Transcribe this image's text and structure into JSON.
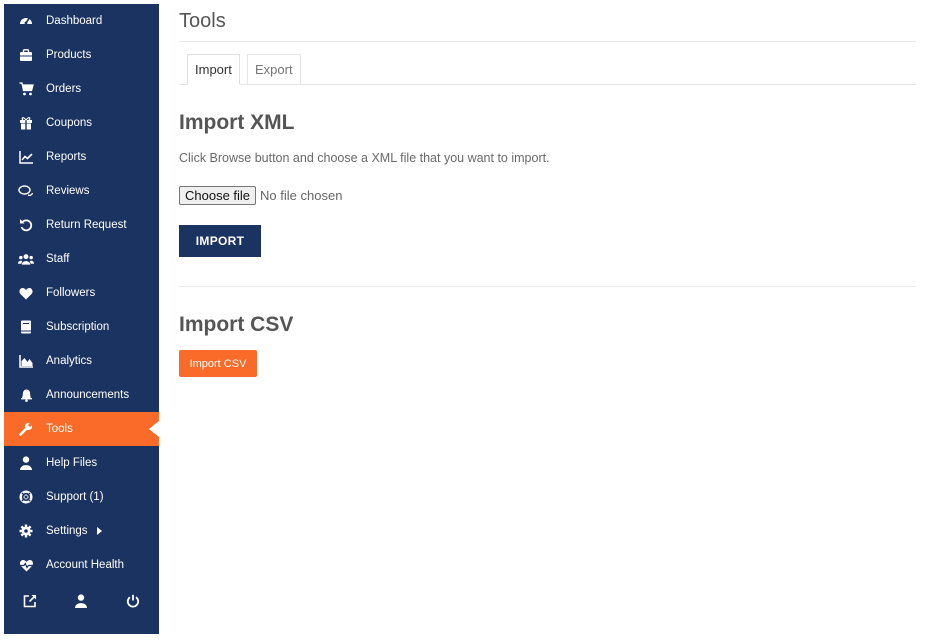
{
  "sidebar": {
    "items": [
      {
        "label": "Dashboard",
        "icon": "dashboard-icon"
      },
      {
        "label": "Products",
        "icon": "briefcase-icon"
      },
      {
        "label": "Orders",
        "icon": "cart-icon"
      },
      {
        "label": "Coupons",
        "icon": "gift-icon"
      },
      {
        "label": "Reports",
        "icon": "line-chart-icon"
      },
      {
        "label": "Reviews",
        "icon": "comments-icon"
      },
      {
        "label": "Return Request",
        "icon": "undo-icon"
      },
      {
        "label": "Staff",
        "icon": "users-icon"
      },
      {
        "label": "Followers",
        "icon": "heart-icon"
      },
      {
        "label": "Subscription",
        "icon": "book-icon"
      },
      {
        "label": "Analytics",
        "icon": "area-chart-icon"
      },
      {
        "label": "Announcements",
        "icon": "bell-icon"
      },
      {
        "label": "Tools",
        "icon": "wrench-icon",
        "active": true
      },
      {
        "label": "Help Files",
        "icon": "user-icon"
      },
      {
        "label": "Support (1)",
        "icon": "life-ring-icon"
      },
      {
        "label": "Settings",
        "icon": "gear-icon"
      },
      {
        "label": "Account Health",
        "icon": "heartbeat-icon"
      }
    ],
    "bottom_icons": [
      "external-link-icon",
      "profile-icon",
      "power-icon"
    ],
    "colors": {
      "background": "#1b3360",
      "active": "#fa6a28"
    }
  },
  "main": {
    "title": "Tools",
    "tabs": [
      {
        "label": "Import",
        "active": true
      },
      {
        "label": "Export",
        "active": false
      }
    ],
    "import_xml": {
      "title": "Import XML",
      "description": "Click Browse button and choose a XML file that you want to import.",
      "choose_file_label": "Choose file",
      "no_file_text": "No file chosen",
      "import_button": "IMPORT"
    },
    "import_csv": {
      "title": "Import CSV",
      "button": "Import CSV"
    }
  }
}
